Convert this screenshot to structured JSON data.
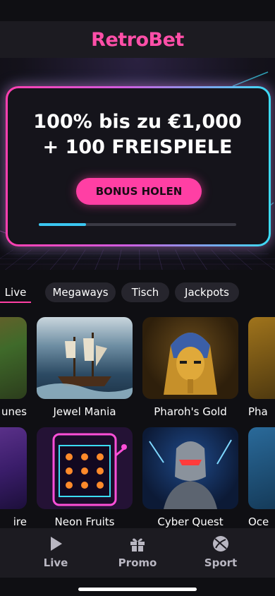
{
  "app": {
    "brand": "RetroBet"
  },
  "hero": {
    "title_line1": "100% bis zu €1,000",
    "title_line2": "+ 100 FREISPIELE",
    "cta_label": "BONUS HOLEN",
    "progress": 0.24
  },
  "tabs": [
    {
      "label": "Live",
      "active": true
    },
    {
      "label": "Megaways",
      "active": false
    },
    {
      "label": "Tisch",
      "active": false
    },
    {
      "label": "Jackpots",
      "active": false
    }
  ],
  "games_row1": [
    {
      "title": "unes"
    },
    {
      "title": "Jewel Mania"
    },
    {
      "title": "Pharoh's Gold"
    },
    {
      "title": "Pha"
    }
  ],
  "games_row2": [
    {
      "title": "ire"
    },
    {
      "title": "Neon Fruits"
    },
    {
      "title": "Cyber Quest"
    },
    {
      "title": "Oce"
    }
  ],
  "nav": [
    {
      "label": "Live",
      "icon": "play-icon"
    },
    {
      "label": "Promo",
      "icon": "gift-icon"
    },
    {
      "label": "Sport",
      "icon": "ball-icon"
    }
  ],
  "colors": {
    "accent_pink": "#ff3fa4",
    "accent_cyan": "#3bc6f0",
    "background": "#0f0f13"
  }
}
